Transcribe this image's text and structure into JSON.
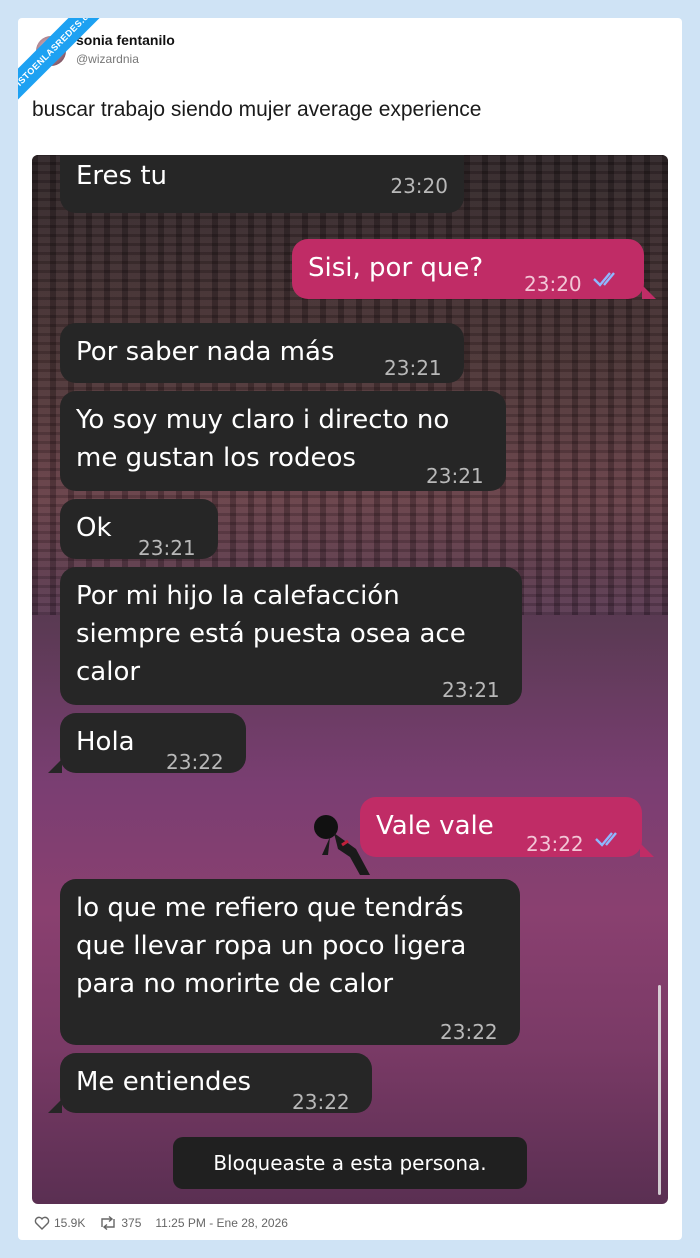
{
  "watermark": "VISTOENLASREDES.com",
  "author": {
    "name": "sonia fentanilo",
    "handle": "@wizardnia"
  },
  "tweet_text": "buscar trabajo siendo mujer average experience",
  "messages": [
    {
      "dir": "in",
      "text": "Eres tu",
      "time": "23:20"
    },
    {
      "dir": "out",
      "text": "Sisi, por que?",
      "time": "23:20"
    },
    {
      "dir": "in",
      "text": "Por saber nada más",
      "time": "23:21"
    },
    {
      "dir": "in",
      "text": "Yo soy muy claro i directo no\nme gustan los rodeos",
      "time": "23:21"
    },
    {
      "dir": "in",
      "text": "Ok",
      "time": "23:21"
    },
    {
      "dir": "in",
      "text": "Por mi hijo la calefacción\nsiempre está puesta osea ace\ncalor",
      "time": "23:21"
    },
    {
      "dir": "in",
      "text": "Hola",
      "time": "23:22"
    },
    {
      "dir": "out",
      "text": "Vale vale",
      "time": "23:22"
    },
    {
      "dir": "in",
      "text": "lo que me refiero que tendrás\nque llevar ropa un poco ligera\npara no morirte de calor",
      "time": "23:22"
    },
    {
      "dir": "in",
      "text": "Me entiendes",
      "time": "23:22"
    }
  ],
  "system_message": "Bloqueaste a esta persona.",
  "footer": {
    "likes": "15.9K",
    "retweets": "375",
    "timestamp": "11:25 PM - Ene 28, 2026"
  },
  "colors": {
    "incoming_bubble": "#262626",
    "outgoing_bubble": "#c02c66",
    "read_ticks": "#8fb8ff"
  }
}
